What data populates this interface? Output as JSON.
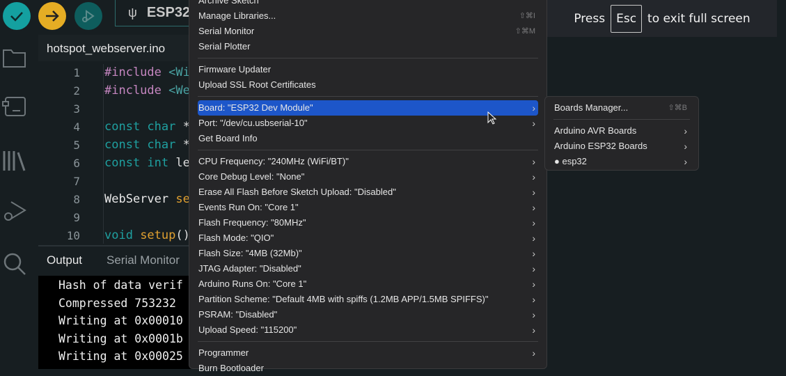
{
  "toolbar": {
    "board_selector": "ESP32"
  },
  "editor": {
    "file_tab": "hotspot_webserver.ino",
    "lines": [
      {
        "n": "1",
        "parts": [
          [
            "#include ",
            "#c586c0"
          ],
          [
            "<Wi",
            "#4aa3a3"
          ]
        ]
      },
      {
        "n": "2",
        "parts": [
          [
            "#include ",
            "#c586c0"
          ],
          [
            "<We",
            "#4aa3a3"
          ]
        ]
      },
      {
        "n": "3",
        "parts": []
      },
      {
        "n": "4",
        "parts": [
          [
            "const char ",
            "#1fa0a0"
          ],
          [
            "*",
            "#ddd"
          ]
        ]
      },
      {
        "n": "5",
        "parts": [
          [
            "const char ",
            "#1fa0a0"
          ],
          [
            "*",
            "#ddd"
          ]
        ]
      },
      {
        "n": "6",
        "parts": [
          [
            "const int ",
            "#1fa0a0"
          ],
          [
            "le",
            "#ddd"
          ]
        ]
      },
      {
        "n": "7",
        "parts": []
      },
      {
        "n": "8",
        "parts": [
          [
            "WebServer ",
            "#e8e8e8"
          ],
          [
            "se",
            "#e0a030"
          ]
        ]
      },
      {
        "n": "9",
        "parts": []
      },
      {
        "n": "10",
        "parts": [
          [
            "void ",
            "#1fa0a0"
          ],
          [
            "setup",
            "#e0a030"
          ],
          [
            "()",
            "#ddd"
          ]
        ]
      }
    ]
  },
  "output_panel": {
    "tabs": [
      "Output",
      "Serial Monitor"
    ],
    "lines": [
      "Hash of data verif",
      "Compressed 753232 ",
      "Writing at 0x00010",
      "Writing at 0x0001b",
      "Writing at 0x00025"
    ]
  },
  "tools_menu": {
    "items": [
      {
        "label": "Archive Sketch"
      },
      {
        "label": "Manage Libraries...",
        "shortcut": "⇧⌘I"
      },
      {
        "label": "Serial Monitor",
        "shortcut": "⇧⌘M"
      },
      {
        "label": "Serial Plotter"
      },
      {
        "sep": true
      },
      {
        "label": "Firmware Updater"
      },
      {
        "label": "Upload SSL Root Certificates"
      },
      {
        "sep": true
      },
      {
        "label": "Board: \"ESP32 Dev Module\"",
        "submenu": true,
        "highlighted": true
      },
      {
        "label": "Port: \"/dev/cu.usbserial-10\"",
        "submenu": true
      },
      {
        "label": "Get Board Info"
      },
      {
        "sep": true
      },
      {
        "label": "CPU Frequency: \"240MHz (WiFi/BT)\"",
        "submenu": true
      },
      {
        "label": "Core Debug Level: \"None\"",
        "submenu": true
      },
      {
        "label": "Erase All Flash Before Sketch Upload: \"Disabled\"",
        "submenu": true
      },
      {
        "label": "Events Run On: \"Core 1\"",
        "submenu": true
      },
      {
        "label": "Flash Frequency: \"80MHz\"",
        "submenu": true
      },
      {
        "label": "Flash Mode: \"QIO\"",
        "submenu": true
      },
      {
        "label": "Flash Size: \"4MB (32Mb)\"",
        "submenu": true
      },
      {
        "label": "JTAG Adapter: \"Disabled\"",
        "submenu": true
      },
      {
        "label": "Arduino Runs On: \"Core 1\"",
        "submenu": true
      },
      {
        "label": "Partition Scheme: \"Default 4MB with spiffs (1.2MB APP/1.5MB SPIFFS)\"",
        "submenu": true
      },
      {
        "label": "PSRAM: \"Disabled\"",
        "submenu": true
      },
      {
        "label": "Upload Speed: \"115200\"",
        "submenu": true
      },
      {
        "sep": true
      },
      {
        "label": "Programmer",
        "submenu": true
      },
      {
        "label": "Burn Bootloader"
      }
    ]
  },
  "board_submenu": {
    "items": [
      {
        "label": "Boards Manager...",
        "shortcut": "⇧⌘B"
      },
      {
        "sep": true
      },
      {
        "label": "Arduino AVR Boards",
        "submenu": true
      },
      {
        "label": "Arduino ESP32 Boards",
        "submenu": true
      },
      {
        "label": "esp32",
        "submenu": true,
        "dot": true
      }
    ]
  },
  "fullscreen_hint": {
    "prefix": "Press",
    "key": "Esc",
    "suffix": "to exit full screen"
  },
  "colors": {
    "verify": "#14a0a0",
    "upload": "#e5ad24",
    "debug": "#0e5d5d",
    "highlight": "#1d56c9"
  }
}
